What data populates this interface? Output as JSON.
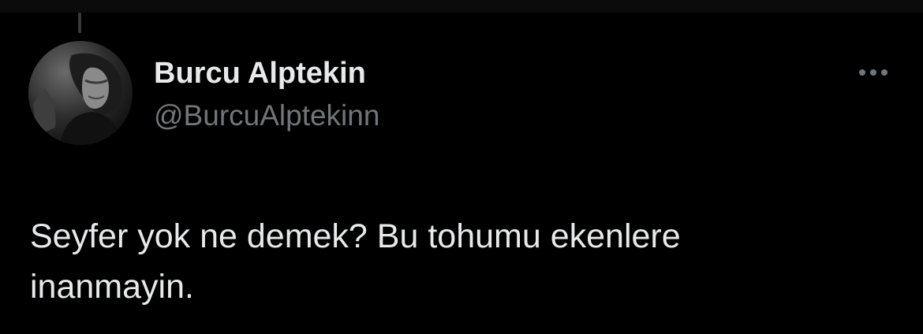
{
  "tweet": {
    "author": {
      "display_name": "Burcu Alptekin",
      "handle": "@BurcuAlptekinn",
      "avatar_icon": "profile-photo"
    },
    "text": "Seyfer yok ne demek? Bu tohumu ekenlere\ninanmayin.",
    "more_icon": "more-horizontal-icon"
  },
  "colors": {
    "background": "#000000",
    "text_primary": "#e7e9ea",
    "text_secondary": "#71767b"
  }
}
